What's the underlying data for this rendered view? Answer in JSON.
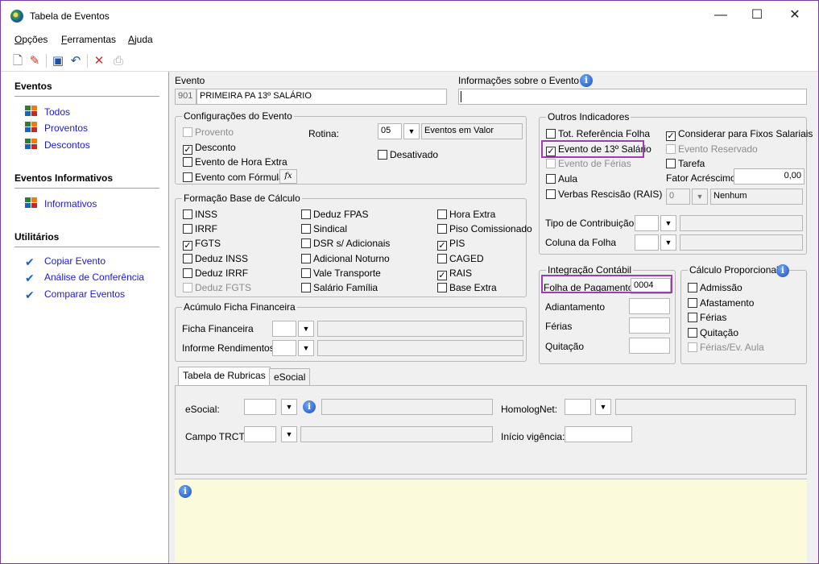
{
  "window": {
    "title": "Tabela de Eventos",
    "minimize": "—",
    "maximize": "☐",
    "close": "✕"
  },
  "menu": {
    "opcoes": "Opções",
    "ferramentas": "Ferramentas",
    "ajuda": "Ajuda"
  },
  "sidebar": {
    "eventos_heading": "Eventos",
    "eventos_items": [
      "Todos",
      "Proventos",
      "Descontos"
    ],
    "informativos_heading": "Eventos Informativos",
    "informativos_items": [
      "Informativos"
    ],
    "utilitarios_heading": "Utilitários",
    "utilitarios_items": [
      "Copiar Evento",
      "Análise de Conferência",
      "Comparar Eventos"
    ]
  },
  "evento": {
    "label": "Evento",
    "code": "901",
    "name": "PRIMEIRA PA 13º SALÁRIO"
  },
  "info_evento": {
    "label": "Informações sobre o Evento",
    "value": ""
  },
  "config": {
    "title": "Configurações do Evento",
    "provento": "Provento",
    "desconto": "Desconto",
    "hora_extra": "Evento de Hora Extra",
    "formula": "Evento com Fórmula",
    "formula_btn": "fx",
    "rotina_label": "Rotina:",
    "rotina_value": "05",
    "rotina_desc": "Eventos em Valor",
    "desativado": "Desativado"
  },
  "base_calculo": {
    "title": "Formação Base de Cálculo",
    "col1": [
      "INSS",
      "IRRF",
      "FGTS",
      "Deduz INSS",
      "Deduz IRRF",
      "Deduz FGTS"
    ],
    "col2": [
      "Deduz FPAS",
      "Sindical",
      "DSR s/ Adicionais",
      "Adicional Noturno",
      "Vale Transporte",
      "Salário Família"
    ],
    "col3": [
      "Hora Extra",
      "Piso Comissionado",
      "PIS",
      "CAGED",
      "RAIS",
      "Base Extra"
    ]
  },
  "acumulo": {
    "title": "Acúmulo Ficha Financeira",
    "ficha": "Ficha Financeira",
    "informe": "Informe Rendimentos"
  },
  "outros": {
    "title": "Outros Indicadores",
    "tot_ref": "Tot. Referência Folha",
    "evento_13": "Evento de 13º Salário",
    "evento_ferias": "Evento de Férias",
    "aula": "Aula",
    "verbas": "Verbas Rescisão (RAIS)",
    "considerar": "Considerar para Fixos Salariais",
    "reservado": "Evento Reservado",
    "tarefa": "Tarefa",
    "fator_label": "Fator Acréscimo",
    "fator_value": "0,00",
    "verbas_code": "0",
    "verbas_desc": "Nenhum",
    "tipo_contrib": "Tipo de Contribuição",
    "coluna_folha": "Coluna da Folha"
  },
  "integracao": {
    "title": "Integração Contábil",
    "folha_label": "Folha de Pagamento",
    "folha_value": "0004",
    "adiantamento": "Adiantamento",
    "ferias": "Férias",
    "quitacao": "Quitação"
  },
  "proporcional": {
    "title": "Cálculo Proporcional",
    "items": [
      "Admissão",
      "Afastamento",
      "Férias",
      "Quitação",
      "Férias/Ev. Aula"
    ]
  },
  "tabs": {
    "rubricas": "Tabela de Rubricas",
    "esocial": "eSocial"
  },
  "rubricas": {
    "esocial": "eSocial:",
    "homolognet": "HomologNet:",
    "campo_trct": "Campo TRCT:",
    "inicio": "Início vigência:"
  },
  "icons": {
    "info": "i"
  }
}
